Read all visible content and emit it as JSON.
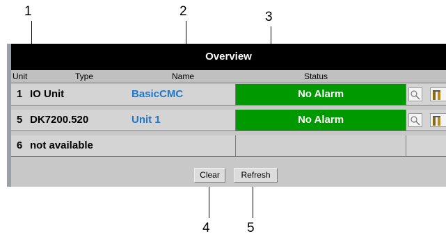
{
  "callouts": [
    "1",
    "2",
    "3",
    "4",
    "5"
  ],
  "panel": {
    "title": "Overview",
    "columns": {
      "unit": "Unit",
      "type": "Type",
      "name": "Name",
      "status": "Status"
    },
    "rows": [
      {
        "unit": "1",
        "type": "IO Unit",
        "name": "BasicCMC",
        "status": "No Alarm"
      },
      {
        "unit": "5",
        "type": "DK7200.520",
        "name": "Unit 1",
        "status": "No Alarm"
      },
      {
        "unit": "6",
        "type": "not available",
        "name": "",
        "status": ""
      }
    ]
  },
  "buttons": {
    "clear": "Clear",
    "refresh": "Refresh"
  },
  "icons": {
    "details": "magnifier-icon",
    "config": "tool-icon"
  },
  "colors": {
    "title_bar": "#000000",
    "status_ok": "#009a00",
    "name_link": "#2078c8"
  }
}
